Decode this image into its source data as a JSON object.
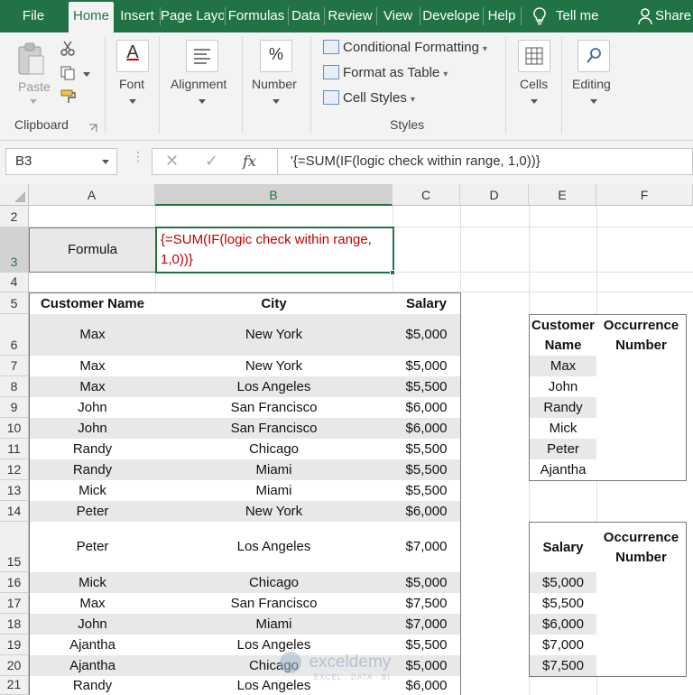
{
  "tabs": [
    "File",
    "Home",
    "Insert",
    "Page Layo",
    "Formulas",
    "Data",
    "Review",
    "View",
    "Develope",
    "Help"
  ],
  "tell_me": "Tell me",
  "share": "Share",
  "ribbon": {
    "paste": "Paste",
    "clipboard": "Clipboard",
    "font": "Font",
    "alignment": "Alignment",
    "number": "Number",
    "conditional_formatting": "Conditional Formatting",
    "format_as_table": "Format as Table",
    "cell_styles": "Cell Styles",
    "styles": "Styles",
    "cells": "Cells",
    "editing": "Editing",
    "number_icon": "%",
    "font_icon": "A"
  },
  "formula_bar": {
    "name_box": "B3",
    "formula": "'{=SUM(IF(logic check within range, 1,0))}",
    "fx": "fx"
  },
  "columns": [
    "A",
    "B",
    "C",
    "D",
    "E",
    "F"
  ],
  "rows": [
    "2",
    "3",
    "4",
    "5",
    "6",
    "7",
    "8",
    "9",
    "10",
    "11",
    "12",
    "13",
    "14",
    "15",
    "16",
    "17",
    "18",
    "19",
    "20",
    "21"
  ],
  "formula_label": "Formula",
  "formula_cell_text": "{=SUM(IF(logic check within range, 1,0))}",
  "main_table": {
    "headers": [
      "Customer Name",
      "City",
      "Salary"
    ],
    "rows": [
      [
        "Max",
        "New York",
        "$5,000"
      ],
      [
        "Max",
        "New York",
        "$5,000"
      ],
      [
        "Max",
        "Los Angeles",
        "$5,500"
      ],
      [
        "John",
        "San Francisco",
        "$6,000"
      ],
      [
        "John",
        "San Francisco",
        "$6,000"
      ],
      [
        "Randy",
        "Chicago",
        "$5,500"
      ],
      [
        "Randy",
        "Miami",
        "$5,500"
      ],
      [
        "Mick",
        "Miami",
        "$5,500"
      ],
      [
        "Peter",
        "New York",
        "$6,000"
      ],
      [
        "Peter",
        "Los Angeles",
        "$7,000"
      ],
      [
        "Mick",
        "Chicago",
        "$5,000"
      ],
      [
        "Max",
        "San Francisco",
        "$7,500"
      ],
      [
        "John",
        "Miami",
        "$7,000"
      ],
      [
        "Ajantha",
        "Los Angeles",
        "$5,500"
      ],
      [
        "Ajantha",
        "Chicago",
        "$5,000"
      ],
      [
        "Randy",
        "Los Angeles",
        "$6,000"
      ]
    ]
  },
  "name_table": {
    "headers": [
      "Customer Name",
      "Occurrence Number"
    ],
    "names": [
      "Max",
      "John",
      "Randy",
      "Mick",
      "Peter",
      "Ajantha"
    ]
  },
  "salary_table": {
    "headers": [
      "Salary",
      "Occurrence Number"
    ],
    "salaries": [
      "$5,000",
      "$5,500",
      "$6,000",
      "$7,000",
      "$7,500"
    ]
  },
  "watermark": "exceldemy",
  "watermark_sub": "EXCEL · DATA · BI",
  "colors": {
    "excel_green": "#217346",
    "formula_red": "#c00000"
  }
}
